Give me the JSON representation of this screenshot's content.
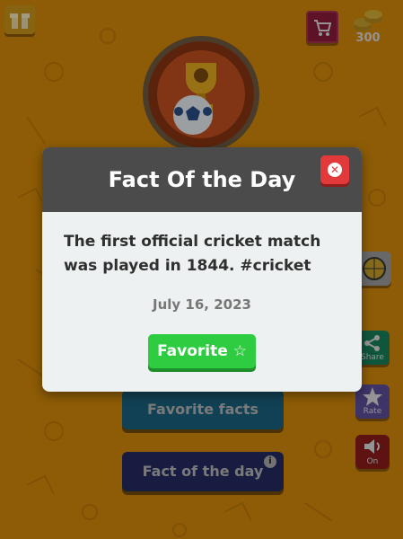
{
  "header": {
    "coin_count": "300"
  },
  "modal": {
    "title": "Fact Of the Day",
    "fact": "The first official cricket match was played in 1844. #cricket",
    "date": "July 16, 2023",
    "favorite_label": "Favorite ☆"
  },
  "side_buttons": {
    "share_label": "Share",
    "rate_label": "Rate",
    "sound_label": "On"
  },
  "menu": {
    "favorite_facts_label": "Favorite facts",
    "fact_of_the_day_label": "Fact of the day"
  },
  "colors": {
    "background": "#d4890a",
    "modal_header": "#4b4b4b",
    "favorite_button": "#2ecc40",
    "close_button": "#e23a3a"
  }
}
